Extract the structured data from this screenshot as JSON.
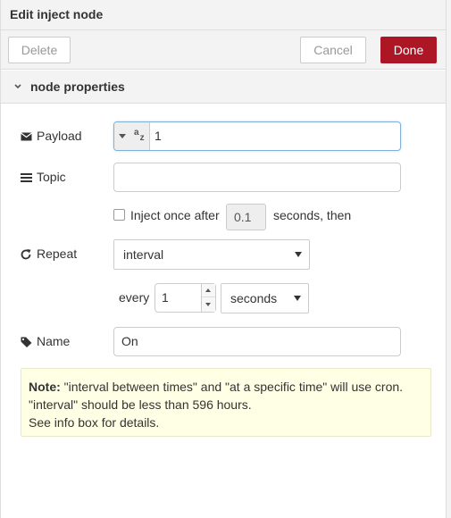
{
  "header": {
    "title": "Edit inject node"
  },
  "toolbar": {
    "delete_label": "Delete",
    "cancel_label": "Cancel",
    "done_label": "Done"
  },
  "section": {
    "title": "node properties",
    "chevron": "chevron-down-icon"
  },
  "form": {
    "payload": {
      "label": "Payload",
      "icon": "envelope-icon",
      "type_icon": "az-string-icon",
      "value": "1"
    },
    "topic": {
      "label": "Topic",
      "icon": "list-icon",
      "value": ""
    },
    "inject_once": {
      "label": "Inject once after",
      "checked": false,
      "delay": "0.1",
      "suffix": "seconds, then"
    },
    "repeat": {
      "label": "Repeat",
      "icon": "refresh-icon",
      "selected": "interval"
    },
    "interval": {
      "every_label": "every",
      "value": "1",
      "unit": "seconds"
    },
    "name": {
      "label": "Name",
      "icon": "tag-icon",
      "value": "On"
    }
  },
  "note": {
    "prefix": "Note:",
    "line1": "\"interval between times\" and \"at a specific time\" will use cron.",
    "line2": "\"interval\" should be less than 596 hours.",
    "line3": "See info box for details."
  },
  "colors": {
    "accent": "#ad1625",
    "note_bg": "#ffffe6",
    "header_bg": "#f3f3f3"
  }
}
